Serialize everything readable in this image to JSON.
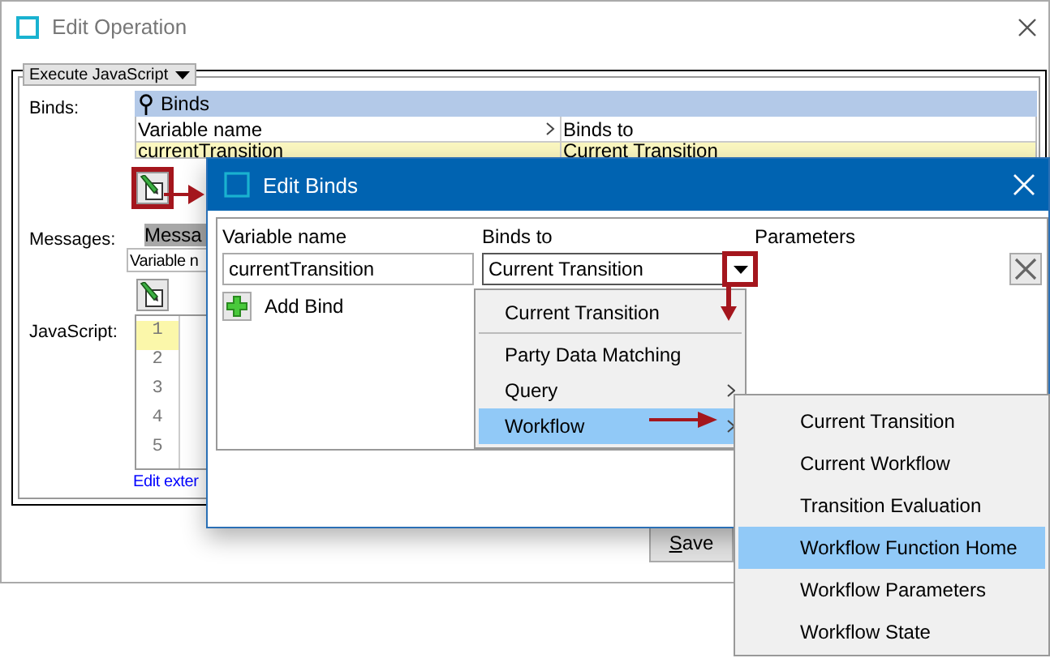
{
  "window": {
    "title": "Edit Operation"
  },
  "operation_type": "Execute JavaScript",
  "binds": {
    "label": "Binds:",
    "header": "Binds",
    "active": true,
    "columns": [
      "Variable name",
      "Binds to"
    ],
    "rows": [
      {
        "cells": [
          "currentTransition",
          "Current Transition"
        ],
        "selected": true
      }
    ],
    "edit_button": {
      "callout": true
    }
  },
  "messages": {
    "label": "Messages:",
    "header": "Messa",
    "active": false,
    "columns": [
      "Variable n"
    ],
    "edit_button": {
      "callout": false
    }
  },
  "javascript": {
    "label": "JavaScript:",
    "lines": [
      {
        "number": "1",
        "highlighted": true
      },
      {
        "number": "2",
        "highlighted": false
      },
      {
        "number": "3",
        "highlighted": false
      },
      {
        "number": "4",
        "highlighted": false
      },
      {
        "number": "5",
        "highlighted": false
      }
    ],
    "link": "Edit exter"
  },
  "buttons": [
    "Save"
  ],
  "dialog": {
    "title": "Edit Binds",
    "columns": [
      "Variable name",
      "Binds to",
      "Parameters"
    ],
    "variable_name": "currentTransition",
    "binds_to": "Current Transition",
    "dropdown_callout": true,
    "add_bind": "Add Bind"
  },
  "dropdown": {
    "items": [
      {
        "label": "Current Transition",
        "selected": false,
        "has_submenu": false,
        "separator_after": true
      },
      {
        "label": "Party Data Matching",
        "selected": false,
        "has_submenu": false,
        "separator_after": false
      },
      {
        "label": "Query",
        "selected": false,
        "has_submenu": true,
        "separator_after": false
      },
      {
        "label": "Workflow",
        "selected": true,
        "has_submenu": true,
        "separator_after": false
      }
    ]
  },
  "submenu": {
    "items": [
      {
        "label": "Current Transition",
        "selected": false
      },
      {
        "label": "Current Workflow",
        "selected": false
      },
      {
        "label": "Transition Evaluation",
        "selected": false
      },
      {
        "label": "Workflow Function Home",
        "selected": true
      },
      {
        "label": "Workflow Parameters",
        "selected": false
      },
      {
        "label": "Workflow State",
        "selected": false
      }
    ]
  }
}
